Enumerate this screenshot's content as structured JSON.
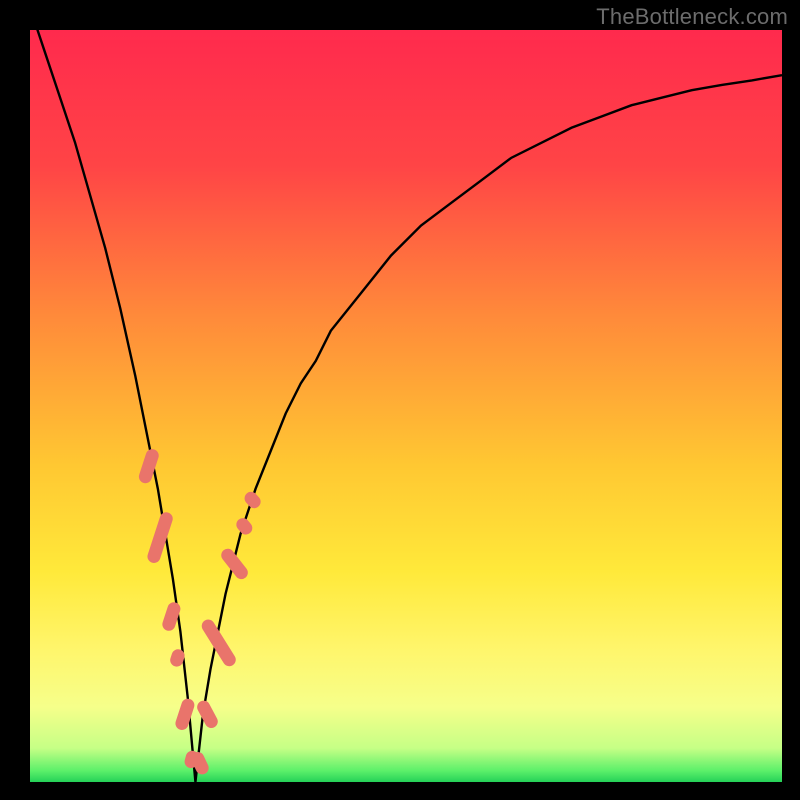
{
  "watermark": "TheBottleneck.com",
  "colors": {
    "frame": "#000000",
    "gradient_stops": [
      {
        "offset": 0.0,
        "color": "#ff2a4d"
      },
      {
        "offset": 0.18,
        "color": "#ff4446"
      },
      {
        "offset": 0.38,
        "color": "#ff8a3a"
      },
      {
        "offset": 0.58,
        "color": "#ffc832"
      },
      {
        "offset": 0.72,
        "color": "#ffe93a"
      },
      {
        "offset": 0.82,
        "color": "#fff56a"
      },
      {
        "offset": 0.9,
        "color": "#f6ff8a"
      },
      {
        "offset": 0.955,
        "color": "#c6ff86"
      },
      {
        "offset": 0.985,
        "color": "#5cf06a"
      },
      {
        "offset": 1.0,
        "color": "#25d158"
      }
    ],
    "curve": "#000000",
    "markers": "#e9746b"
  },
  "chart_data": {
    "type": "line",
    "title": "",
    "xlabel": "",
    "ylabel": "",
    "xlim": [
      0,
      100
    ],
    "ylim": [
      0,
      100
    ],
    "grid": false,
    "legend": false,
    "x_minimum": 22,
    "series": [
      {
        "name": "bottleneck-curve",
        "x": [
          0,
          2,
          4,
          6,
          8,
          10,
          12,
          14,
          16,
          17,
          18,
          19,
          20,
          21,
          22,
          23,
          24,
          25,
          26,
          27,
          28,
          29,
          30,
          32,
          34,
          36,
          38,
          40,
          44,
          48,
          52,
          56,
          60,
          64,
          68,
          72,
          76,
          80,
          84,
          88,
          92,
          96,
          100
        ],
        "y": [
          103,
          97,
          91,
          85,
          78,
          71,
          63,
          54,
          44,
          39,
          33,
          27,
          20,
          11,
          0,
          9,
          15,
          20,
          25,
          29,
          33,
          36,
          39,
          44,
          49,
          53,
          56,
          60,
          65,
          70,
          74,
          77,
          80,
          83,
          85,
          87,
          88.5,
          90,
          91,
          92,
          92.7,
          93.3,
          94
        ]
      }
    ],
    "markers": {
      "name": "benchmark-points",
      "shape": "rounded-rect",
      "color": "#e9746b",
      "points": [
        {
          "x": 15.8,
          "y": 42.0,
          "len": 6.0,
          "angle": -72
        },
        {
          "x": 17.3,
          "y": 32.5,
          "len": 9.0,
          "angle": -72
        },
        {
          "x": 18.8,
          "y": 22.0,
          "len": 5.0,
          "angle": -72
        },
        {
          "x": 19.6,
          "y": 16.5,
          "len": 3.0,
          "angle": -72
        },
        {
          "x": 20.6,
          "y": 9.0,
          "len": 5.5,
          "angle": -72
        },
        {
          "x": 21.5,
          "y": 3.0,
          "len": 3.0,
          "angle": -75
        },
        {
          "x": 22.6,
          "y": 2.5,
          "len": 4.0,
          "angle": 65
        },
        {
          "x": 23.6,
          "y": 9.0,
          "len": 5.0,
          "angle": 62
        },
        {
          "x": 25.1,
          "y": 18.5,
          "len": 9.0,
          "angle": 58
        },
        {
          "x": 27.2,
          "y": 29.0,
          "len": 6.0,
          "angle": 52
        },
        {
          "x": 28.5,
          "y": 34.0,
          "len": 3.0,
          "angle": 50
        },
        {
          "x": 29.6,
          "y": 37.5,
          "len": 3.0,
          "angle": 48
        }
      ]
    }
  }
}
